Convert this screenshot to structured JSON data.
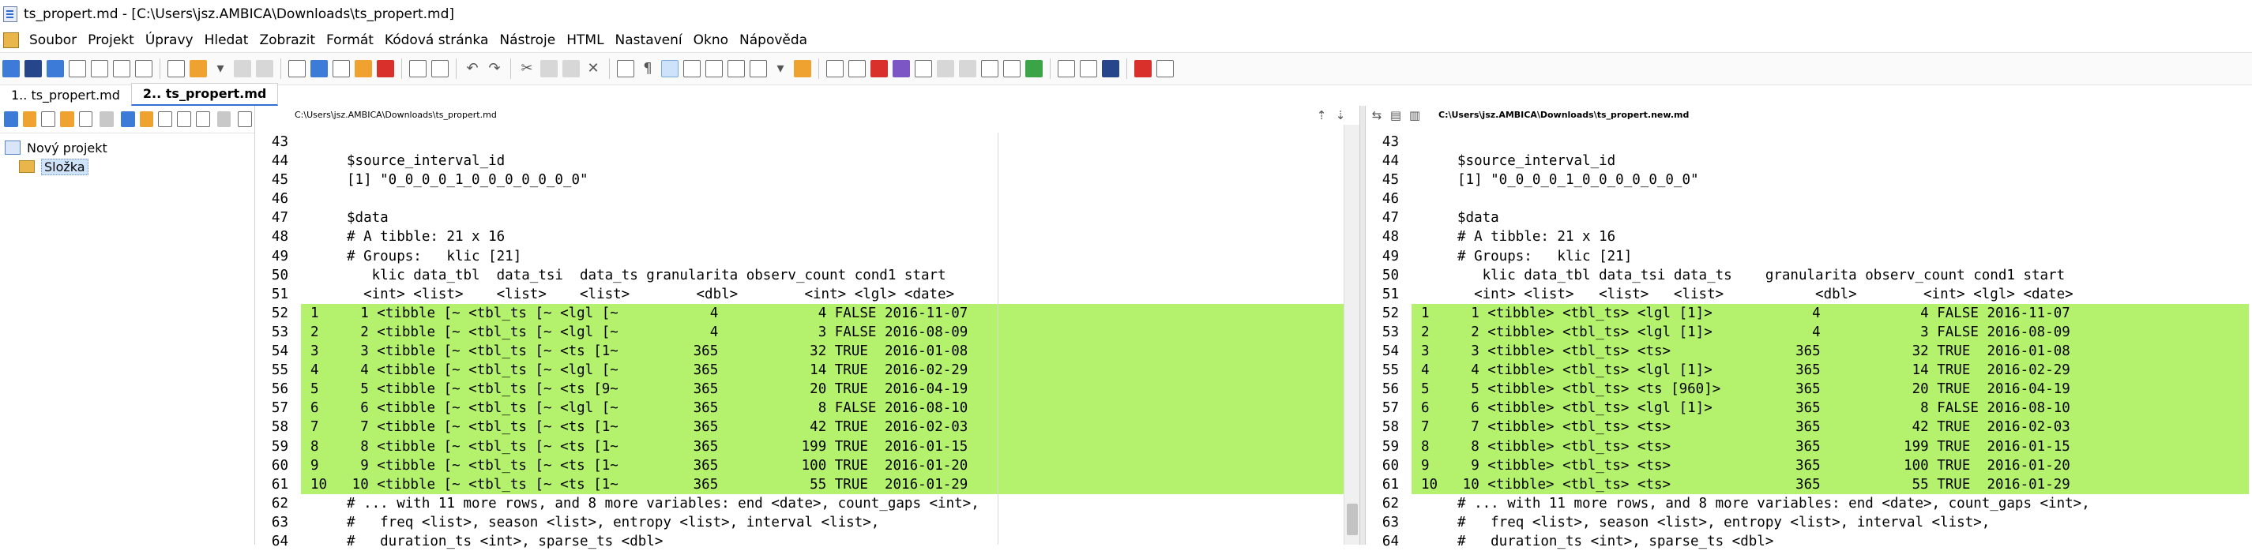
{
  "window": {
    "title": "ts_propert.md - [C:\\Users\\jsz.AMBICA\\Downloads\\ts_propert.md]"
  },
  "menu": [
    "Soubor",
    "Projekt",
    "Úpravy",
    "Hledat",
    "Zobrazit",
    "Formát",
    "Kódová stránka",
    "Nástroje",
    "HTML",
    "Nastavení",
    "Okno",
    "Nápověda"
  ],
  "tabs": [
    {
      "label": "1.. ts_propert.md",
      "active": false
    },
    {
      "label": "2.. ts_propert.md",
      "active": true
    }
  ],
  "sidebar": {
    "project_label": "Nový projekt",
    "folder_label": "Složka"
  },
  "left_pane": {
    "path": "C:\\Users\\jsz.AMBICA\\Downloads\\ts_propert.md",
    "lines": [
      {
        "n": "43",
        "text": "",
        "diff": false
      },
      {
        "n": "44",
        "text": "$source_interval_id",
        "diff": false
      },
      {
        "n": "45",
        "text": "[1] \"0_0_0_0_1_0_0_0_0_0_0_0\"",
        "diff": false
      },
      {
        "n": "46",
        "text": "",
        "diff": false
      },
      {
        "n": "47",
        "text": "$data",
        "diff": false
      },
      {
        "n": "48",
        "text": "# A tibble: 21 x 16",
        "diff": false
      },
      {
        "n": "49",
        "text": "# Groups:   klic [21]",
        "diff": false
      },
      {
        "n": "50",
        "text": "   klic data_tbl  data_tsi  data_ts granularita observ_count cond1 start",
        "diff": false
      },
      {
        "n": "51",
        "text": "  <int> <list>    <list>    <list>        <dbl>        <int> <lgl> <date>",
        "diff": false
      },
      {
        "n": "52",
        "text": "1     1 <tibble [~ <tbl_ts [~ <lgl [~           4            4 FALSE 2016-11-07",
        "diff": true
      },
      {
        "n": "53",
        "text": "2     2 <tibble [~ <tbl_ts [~ <lgl [~           4            3 FALSE 2016-08-09",
        "diff": true
      },
      {
        "n": "54",
        "text": "3     3 <tibble [~ <tbl_ts [~ <ts [1~         365           32 TRUE  2016-01-08",
        "diff": true
      },
      {
        "n": "55",
        "text": "4     4 <tibble [~ <tbl_ts [~ <lgl [~         365           14 TRUE  2016-02-29",
        "diff": true
      },
      {
        "n": "56",
        "text": "5     5 <tibble [~ <tbl_ts [~ <ts [9~         365           20 TRUE  2016-04-19",
        "diff": true
      },
      {
        "n": "57",
        "text": "6     6 <tibble [~ <tbl_ts [~ <lgl [~         365            8 FALSE 2016-08-10",
        "diff": true
      },
      {
        "n": "58",
        "text": "7     7 <tibble [~ <tbl_ts [~ <ts [1~         365           42 TRUE  2016-02-03",
        "diff": true
      },
      {
        "n": "59",
        "text": "8     8 <tibble [~ <tbl_ts [~ <ts [1~         365          199 TRUE  2016-01-15",
        "diff": true
      },
      {
        "n": "60",
        "text": "9     9 <tibble [~ <tbl_ts [~ <ts [1~         365          100 TRUE  2016-01-20",
        "diff": true
      },
      {
        "n": "61",
        "text": "10   10 <tibble [~ <tbl_ts [~ <ts [1~         365           55 TRUE  2016-01-29",
        "diff": true
      },
      {
        "n": "62",
        "text": "# ... with 11 more rows, and 8 more variables: end <date>, count_gaps <int>,",
        "diff": false
      },
      {
        "n": "63",
        "text": "#   freq <list>, season <list>, entropy <list>, interval <list>,",
        "diff": false
      },
      {
        "n": "64",
        "text": "#   duration_ts <int>, sparse_ts <dbl>",
        "diff": false
      }
    ]
  },
  "right_pane": {
    "path": "C:\\Users\\jsz.AMBICA\\Downloads\\ts_propert.new.md",
    "lines": [
      {
        "n": "43",
        "text": "",
        "diff": false
      },
      {
        "n": "44",
        "text": "$source_interval_id",
        "diff": false
      },
      {
        "n": "45",
        "text": "[1] \"0_0_0_0_1_0_0_0_0_0_0_0\"",
        "diff": false
      },
      {
        "n": "46",
        "text": "",
        "diff": false
      },
      {
        "n": "47",
        "text": "$data",
        "diff": false
      },
      {
        "n": "48",
        "text": "# A tibble: 21 x 16",
        "diff": false
      },
      {
        "n": "49",
        "text": "# Groups:   klic [21]",
        "diff": false
      },
      {
        "n": "50",
        "text": "   klic data_tbl data_tsi data_ts    granularita observ_count cond1 start",
        "diff": false
      },
      {
        "n": "51",
        "text": "  <int> <list>   <list>   <list>           <dbl>        <int> <lgl> <date>",
        "diff": false
      },
      {
        "n": "52",
        "text": "1     1 <tibble> <tbl_ts> <lgl [1]>            4            4 FALSE 2016-11-07",
        "diff": true
      },
      {
        "n": "53",
        "text": "2     2 <tibble> <tbl_ts> <lgl [1]>            4            3 FALSE 2016-08-09",
        "diff": true
      },
      {
        "n": "54",
        "text": "3     3 <tibble> <tbl_ts> <ts>               365           32 TRUE  2016-01-08",
        "diff": true
      },
      {
        "n": "55",
        "text": "4     4 <tibble> <tbl_ts> <lgl [1]>          365           14 TRUE  2016-02-29",
        "diff": true
      },
      {
        "n": "56",
        "text": "5     5 <tibble> <tbl_ts> <ts [960]>         365           20 TRUE  2016-04-19",
        "diff": true
      },
      {
        "n": "57",
        "text": "6     6 <tibble> <tbl_ts> <lgl [1]>          365            8 FALSE 2016-08-10",
        "diff": true
      },
      {
        "n": "58",
        "text": "7     7 <tibble> <tbl_ts> <ts>               365           42 TRUE  2016-02-03",
        "diff": true
      },
      {
        "n": "59",
        "text": "8     8 <tibble> <tbl_ts> <ts>               365          199 TRUE  2016-01-15",
        "diff": true
      },
      {
        "n": "60",
        "text": "9     9 <tibble> <tbl_ts> <ts>               365          100 TRUE  2016-01-20",
        "diff": true
      },
      {
        "n": "61",
        "text": "10   10 <tibble> <tbl_ts> <ts>               365           55 TRUE  2016-01-29",
        "diff": true
      },
      {
        "n": "62",
        "text": "# ... with 11 more rows, and 8 more variables: end <date>, count_gaps <int>,",
        "diff": false
      },
      {
        "n": "63",
        "text": "#   freq <list>, season <list>, entropy <list>, interval <list>,",
        "diff": false
      },
      {
        "n": "64",
        "text": "#   duration_ts <int>, sparse_ts <dbl>",
        "diff": false
      }
    ]
  },
  "colors": {
    "diff_highlight": "#b4f26d",
    "active_tab_accent": "#2f6fd6"
  }
}
